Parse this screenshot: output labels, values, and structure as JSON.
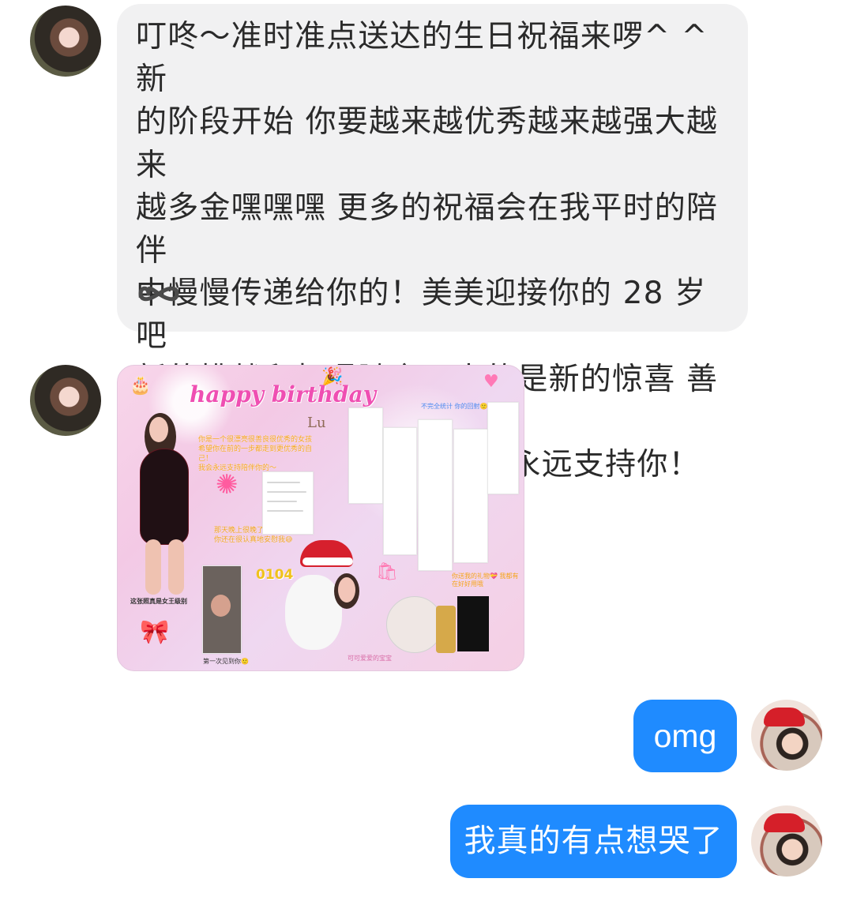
{
  "messages": {
    "incoming": {
      "text": "叮咚～准时准点送达的生日祝福来啰^ ^新\n的阶段开始 你要越来越优秀越来越强大越来\n越多金嘿嘿嘿 更多的祝福会在我平时的陪伴\n中慢慢传递给你的！美美迎接你的 28 岁吧\n新的挑战和机遇随之而来的是新的惊喜 善良\n热心友爱的女孩子 Lu",
      "tail": "我永远支持你！",
      "emoji_heart": "brown-heart-icon",
      "emoji_infinity": "infinity-icon"
    },
    "image_card": {
      "title": "happy birthday",
      "name": "Lu",
      "greeting": "你是一个很漂亮很善良很优秀的女孩\n希望你在前的一步都走到更优秀的自己！\n我会永远支持陪伴你的～",
      "memory": "那天晚上很晚了\n你还在很认真地安慰我😅",
      "date": "0104",
      "caption_left": "这张照真是女王级别",
      "caption_first_meet": "第一次见到你🙂",
      "caption_stats": "不完全统计\n你的回射🙂",
      "caption_gifts": "你送我的礼物💝\n我都有在好好用哦",
      "caption_baby": "可可爱爱的宝宝"
    },
    "outgoing": [
      {
        "text": "omg"
      },
      {
        "text": "我真的有点想哭了"
      }
    ]
  },
  "colors": {
    "incoming_bubble": "#f1f1f2",
    "outgoing_bubble": "#1f8bff",
    "accent_pink": "#ef4fb2",
    "heart_brown": "#7a4b2b"
  }
}
